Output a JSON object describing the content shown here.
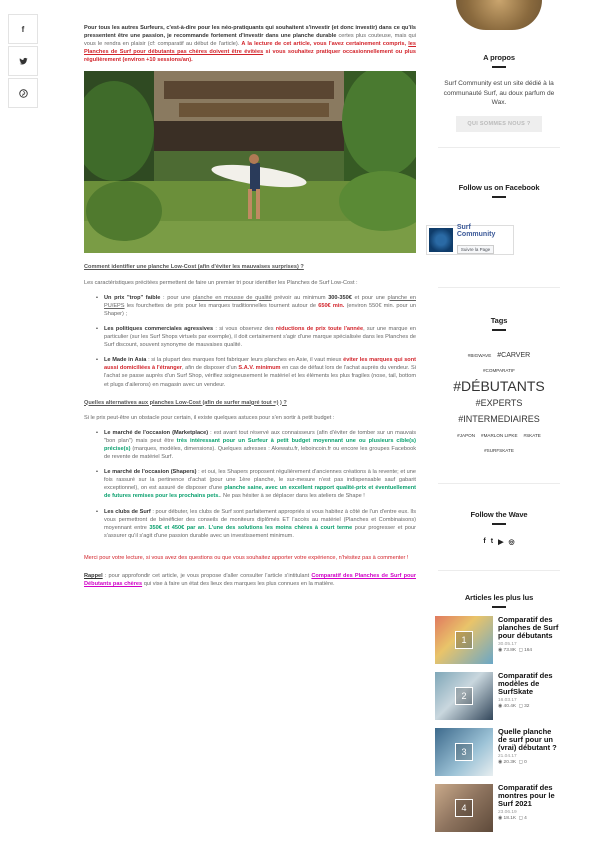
{
  "share": [
    {
      "icon": "facebook-icon",
      "glyph": "f"
    },
    {
      "icon": "twitter-icon",
      "glyph": "t"
    },
    {
      "icon": "pinterest-icon",
      "glyph": "p"
    }
  ],
  "article": {
    "p1_a": "Pour tous les autres Surfeurs, c'est-à-dire pour les néo-pratiquants qui souhaitent s'investir (et donc investir) dans ce qu'ils pressentent être une passion, je recommande fortement d'investir dans une planche durable",
    "p1_b": " certes plus couteuse, mais qui vous le rendra en plaisir (cf: comparatif au début de l'article). ",
    "p1_c": "A la lecture de cet article, vous l'avez certainement compris, ",
    "p1_d": "les Planches de Surf pour débutants pas chères doivent être évitées",
    "p1_e": " si vous souhaitez pratiquer occasionnellement ou plus régulièrement (environ +10 sessions/an).",
    "subhead1": "Comment identifier une planche Low-Cost (afin d'éviter les mauvaises surprises) ?",
    "p2": "Les caractéristiques précitées permettent de faire un premier tri pour identifier les Planches de Surf Low-Cost :",
    "li1_a": "Un prix \"trop\" faible",
    "li1_b": " : pour une ",
    "li1_c": "planche en mousse de qualité",
    "li1_d": " prévoir au minimum ",
    "li1_e": "300-350€",
    "li1_f": " et pour une ",
    "li1_g": "planche en PU/EPS",
    "li1_h": " les fourchettes de prix pour les marques traditionnelles tournent autour de ",
    "li1_i": "650€ min.",
    "li1_j": " (environ 550€ min. pour un Shaper) ;",
    "li2_a": "Les politiques commerciales agressives",
    "li2_b": " : si vous observez des ",
    "li2_c": "réductions de prix toute l'année",
    "li2_d": ", sur une marque en particulier (sur les Surf Shops virtuels par exemple), il doit certainement s'agir d'une marque spécialisée dans les Planches de Surf discount, souvent synonyme de mauvaises qualité.",
    "li3_a": "Le Made in Asia",
    "li3_b": " : si la plupart des marques font fabriquer leurs planches en Asie, il vaut mieux ",
    "li3_c": "éviter les marques qui sont aussi domiciliées à l'étranger",
    "li3_d": ", afin de disposer d'un ",
    "li3_e": "S.A.V. minimum",
    "li3_f": " en cas de défaut lors de l'achat auprès du vendeur. Si l'achat se passe auprès d'un Surf Shop, vérifiez soigneusement le matériel et les éléments les plus fragiles (nose, tail, bottom et plugs d'ailerons) en magasin avec un vendeur.",
    "subhead2": "Quelles alternatives aux planches Low-Cost (afin de surfer malgré tout =) ) ?",
    "p3": "Si le prix peut-être un obstacle pour certain, il existe quelques astuces pour s'en sortir à petit budget :",
    "li4_a": "Le marché de l'occasion (Marketplace)",
    "li4_b": " : est avant tout réservé aux connaisseurs (afin d'éviter de tomber sur un mauvais \"bon plan\") mais peut être ",
    "li4_c": "très intéressant pour un Surfeur à petit budget moyennant une ou plusieurs cible(s) précise(s)",
    "li4_d": " (marques, modèles, dimensions). Quelques adresses : Akewatu.fr, leboincoin.fr ou encore les groupes Facebook de revente de matériel Surf.",
    "li5_a": "Le marché de l'occasion (Shapers)",
    "li5_b": " : et oui, les Shapers proposent régulièrement d'anciennes créations à la revente; et une fois rassuré sur la pertinence d'achat (pour une 1ère planche, le sur-mesure n'est pas indispensable sauf gabarit exceptionnel), on est assuré de disposer d'une ",
    "li5_c": "planche saine, avec un excellent rapport qualité-prix et éventuellement de futures remises pour les prochains pets.",
    "li5_d": ". Ne pas hésiter à se déplacer dans les ateliers de Shape !",
    "li6_a": "Les clubs de Surf",
    "li6_b": " : pour débuter, les clubs de Surf sont parfaitement appropriés si vous habitez à côté de l'un d'entre eux. Ils vous permettront de bénéficier des conseils de moniteurs diplômés ET l'accès au matériel (Planches et Combinaisons) moyennant entre ",
    "li6_c": "350€ et 450€ par an",
    "li6_d": ". ",
    "li6_e": "L'une des solutions les moins chères à court terme",
    "li6_f": " pour progresser et pour s'assurer qu'il s'agit d'une passion durable avec un investissement minimum.",
    "thanks": "Merci pour votre lecture, si vous avez des questions ou que vous souhaitez apporter votre expérience, n'hésitez pas à commenter !",
    "rappel_a": "Rappel",
    "rappel_b": " : pour approfondir cet article, je vous propose d'aller consulter l'article s'intitulant ",
    "rappel_c": "Comparatif des Planches de Surf pour Débutants pas chères",
    "rappel_d": " qui vise à faire un état des lieux des marques les plus connues en la matière."
  },
  "sidebar": {
    "apropos_title": "A propos",
    "apropos_text": "Surf Community est un site dédié à la communauté Surf, au doux parfum de Wax.",
    "qui_button": "QUI SOMMES NOUS ?",
    "facebook_title": "Follow us on Facebook",
    "fb_name": "Surf Community",
    "fb_like": "Suivre la Page",
    "tags_title": "Tags",
    "tags": [
      {
        "label": "#bigwave",
        "size": 4.6
      },
      {
        "label": "#carver",
        "size": 7
      },
      {
        "label": "#comparatif",
        "size": 4.6
      },
      {
        "label": "#débutants",
        "size": 14
      },
      {
        "label": "#experts",
        "size": 9
      },
      {
        "label": "#intermediaires",
        "size": 9
      },
      {
        "label": "#japon",
        "size": 4.6
      },
      {
        "label": "#marlon lipke",
        "size": 4.6
      },
      {
        "label": "#skate",
        "size": 4.6
      },
      {
        "label": "#surfskate",
        "size": 4.6
      }
    ],
    "wave_title": "Follow the Wave",
    "social": [
      "f",
      "t",
      "▶",
      "◎"
    ],
    "articles_title": "Articles les plus lus",
    "articles": [
      {
        "num": "1",
        "title": "Comparatif des planches de Surf pour débutants",
        "date": "30.05.17",
        "views": "73.8K",
        "comments": "164",
        "c1": "#e07a5f",
        "c2": "#6aa7c7"
      },
      {
        "num": "2",
        "title": "Comparatif des modèles de SurfSkate",
        "date": "16.03.17",
        "views": "40.4K",
        "comments": "32",
        "c1": "#7fa7b8",
        "c2": "#33475b"
      },
      {
        "num": "3",
        "title": "Quelle planche de surf pour un (vrai) débutant ?",
        "date": "21.04.17",
        "views": "20.3K",
        "comments": "0",
        "c1": "#3d6a8c",
        "c2": "#9cc2d6"
      },
      {
        "num": "4",
        "title": "Comparatif des montres pour le Surf 2021",
        "date": "23.06.19",
        "views": "18.1K",
        "comments": "4",
        "c1": "#c9a98a",
        "c2": "#5e4a3a"
      }
    ]
  }
}
